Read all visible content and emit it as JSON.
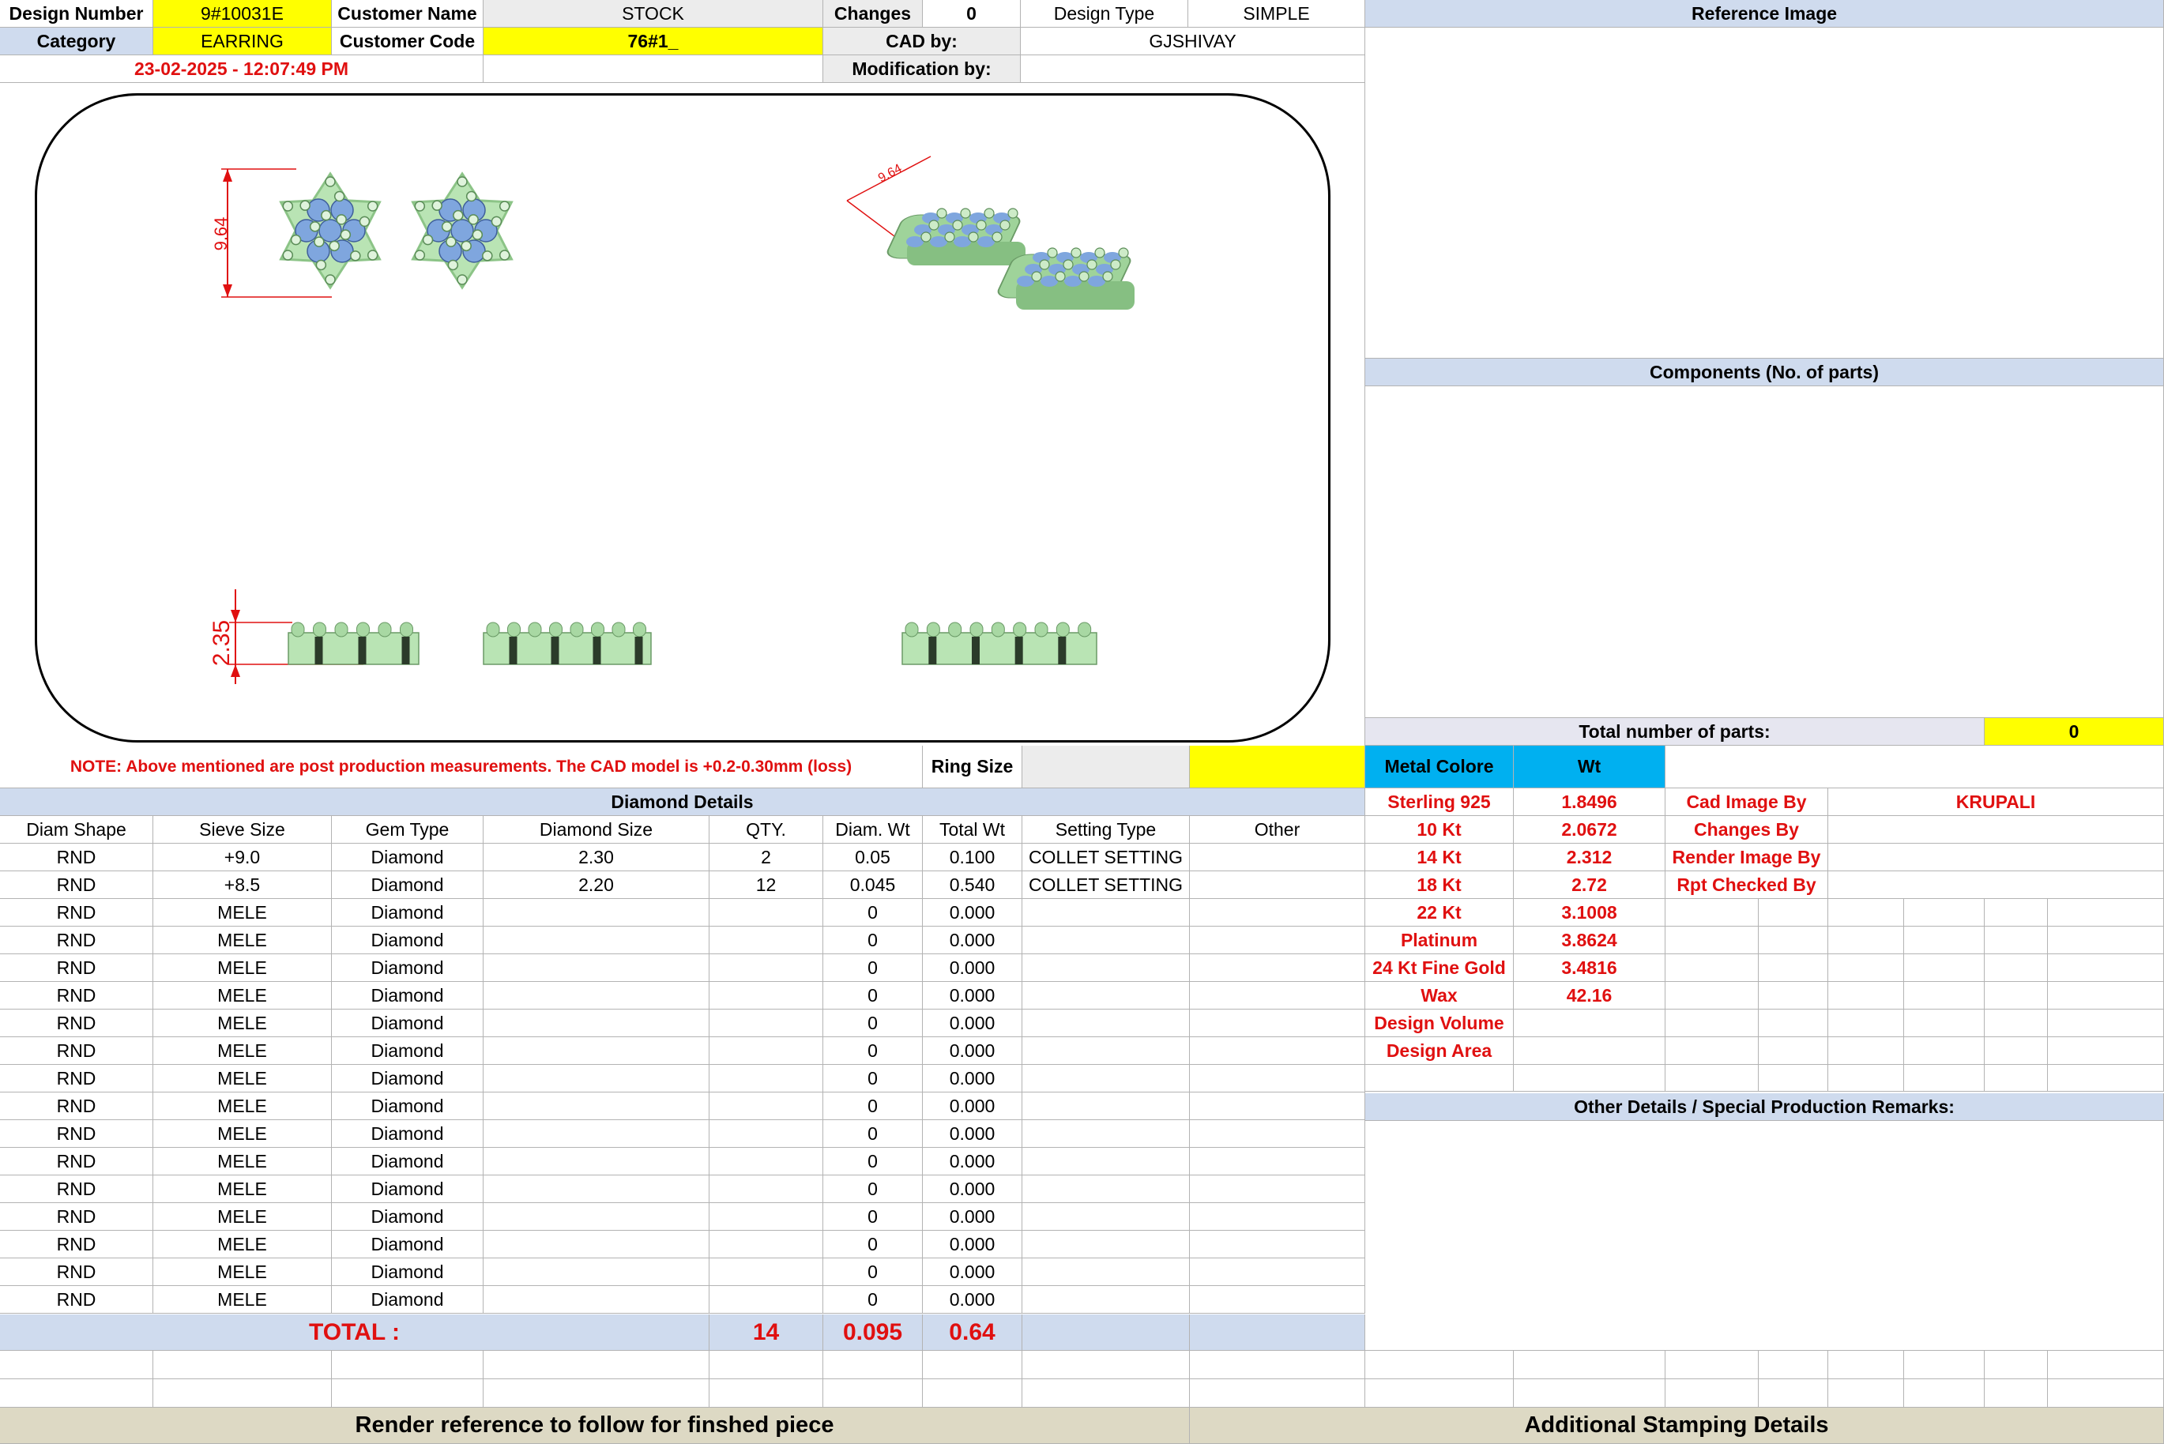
{
  "header": {
    "design_number_label": "Design Number",
    "design_number": "9#10031E",
    "customer_name_label": "Customer Name",
    "customer_name": "STOCK",
    "changes_label": "Changes",
    "changes": "0",
    "design_type_label": "Design Type",
    "design_type": "SIMPLE",
    "category_label": "Category",
    "category": "EARRING",
    "customer_code_label": "Customer Code",
    "customer_code": "76#1_",
    "cad_by_label": "CAD by:",
    "cad_by": "GJSHIVAY",
    "timestamp": "23-02-2025 - 12:07:49 PM",
    "modification_by_label": "Modification by:"
  },
  "right_panel": {
    "reference_image": "Reference Image",
    "components": "Components (No. of parts)",
    "total_parts_label": "Total number of parts:",
    "total_parts": "0",
    "other_details": "Other Details / Special Production Remarks:"
  },
  "drawing": {
    "dim_top": "9.64",
    "dim_side": "2.35",
    "dim_iso": "9.64"
  },
  "note": "NOTE: Above mentioned are post production measurements. The CAD model is +0.2-0.30mm (loss)",
  "ring_size_label": "Ring Size",
  "metal": {
    "header_label": "Metal Colore",
    "header_wt": "Wt",
    "rows": [
      {
        "name": "Sterling 925",
        "wt": "1.8496"
      },
      {
        "name": "10 Kt",
        "wt": "2.0672"
      },
      {
        "name": "14 Kt",
        "wt": "2.312"
      },
      {
        "name": "18 Kt",
        "wt": "2.72"
      },
      {
        "name": "22 Kt",
        "wt": "3.1008"
      },
      {
        "name": "Platinum",
        "wt": "3.8624"
      },
      {
        "name": "24 Kt Fine Gold",
        "wt": "3.4816"
      },
      {
        "name": "Wax",
        "wt": "42.16"
      },
      {
        "name": "Design Volume",
        "wt": ""
      },
      {
        "name": "Design Area",
        "wt": ""
      }
    ]
  },
  "credits": [
    {
      "label": "Cad Image By",
      "value": "KRUPALI"
    },
    {
      "label": "Changes By",
      "value": ""
    },
    {
      "label": "Render Image By",
      "value": ""
    },
    {
      "label": "Rpt Checked By",
      "value": ""
    }
  ],
  "diamond": {
    "title": "Diamond Details",
    "columns": [
      "Diam Shape",
      "Sieve Size",
      "Gem Type",
      "Diamond Size",
      "QTY.",
      "Diam. Wt",
      "Total Wt",
      "Setting Type",
      "Other"
    ],
    "rows": [
      [
        "RND",
        "+9.0",
        "Diamond",
        "2.30",
        "2",
        "0.05",
        "0.100",
        "COLLET SETTING",
        ""
      ],
      [
        "RND",
        "+8.5",
        "Diamond",
        "2.20",
        "12",
        "0.045",
        "0.540",
        "COLLET SETTING",
        ""
      ],
      [
        "RND",
        "MELE",
        "Diamond",
        "",
        "",
        "0",
        "0.000",
        "",
        ""
      ],
      [
        "RND",
        "MELE",
        "Diamond",
        "",
        "",
        "0",
        "0.000",
        "",
        ""
      ],
      [
        "RND",
        "MELE",
        "Diamond",
        "",
        "",
        "0",
        "0.000",
        "",
        ""
      ],
      [
        "RND",
        "MELE",
        "Diamond",
        "",
        "",
        "0",
        "0.000",
        "",
        ""
      ],
      [
        "RND",
        "MELE",
        "Diamond",
        "",
        "",
        "0",
        "0.000",
        "",
        ""
      ],
      [
        "RND",
        "MELE",
        "Diamond",
        "",
        "",
        "0",
        "0.000",
        "",
        ""
      ],
      [
        "RND",
        "MELE",
        "Diamond",
        "",
        "",
        "0",
        "0.000",
        "",
        ""
      ],
      [
        "RND",
        "MELE",
        "Diamond",
        "",
        "",
        "0",
        "0.000",
        "",
        ""
      ],
      [
        "RND",
        "MELE",
        "Diamond",
        "",
        "",
        "0",
        "0.000",
        "",
        ""
      ],
      [
        "RND",
        "MELE",
        "Diamond",
        "",
        "",
        "0",
        "0.000",
        "",
        ""
      ],
      [
        "RND",
        "MELE",
        "Diamond",
        "",
        "",
        "0",
        "0.000",
        "",
        ""
      ],
      [
        "RND",
        "MELE",
        "Diamond",
        "",
        "",
        "0",
        "0.000",
        "",
        ""
      ],
      [
        "RND",
        "MELE",
        "Diamond",
        "",
        "",
        "0",
        "0.000",
        "",
        ""
      ],
      [
        "RND",
        "MELE",
        "Diamond",
        "",
        "",
        "0",
        "0.000",
        "",
        ""
      ],
      [
        "RND",
        "MELE",
        "Diamond",
        "",
        "",
        "0",
        "0.000",
        "",
        ""
      ]
    ],
    "total_label": "TOTAL :",
    "total_qty": "14",
    "total_diam_wt": "0.095",
    "total_wt": "0.64"
  },
  "footer": {
    "render_ref": "Render reference to follow for finshed piece",
    "stamping": "Additional Stamping Details"
  },
  "colors": {
    "highlight": "#ffff00",
    "header_blue": "#cfdbee",
    "metal_header": "#00b0f0",
    "value_red": "#e01010",
    "footer_tan": "#ddd9c4",
    "model_green": "#b9e4b4",
    "stone_blue": "#7fa6de"
  }
}
